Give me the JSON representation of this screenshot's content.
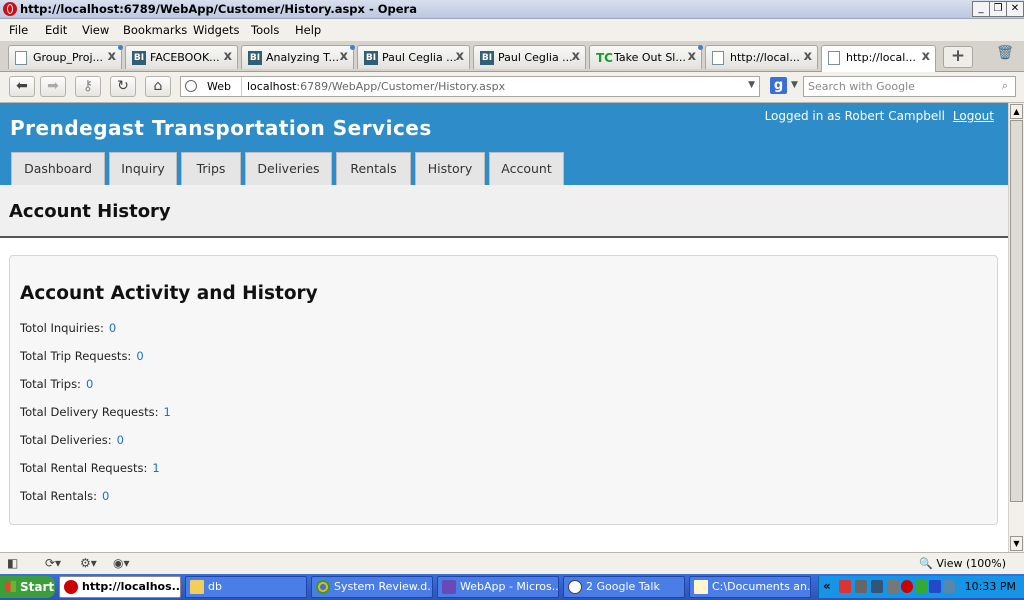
{
  "window": {
    "title": "http://localhost:6789/WebApp/Customer/History.aspx - Opera"
  },
  "menu": [
    "File",
    "Edit",
    "View",
    "Bookmarks",
    "Widgets",
    "Tools",
    "Help"
  ],
  "tabs": [
    {
      "label": "Group_Proj...",
      "icon": "page-icon"
    },
    {
      "label": "FACEBOOK...",
      "icon": "bi-icon"
    },
    {
      "label": "Analyzing T...",
      "icon": "bi-icon"
    },
    {
      "label": "Paul Ceglia ...",
      "icon": "bi-icon"
    },
    {
      "label": "Paul Ceglia ...",
      "icon": "bi-icon"
    },
    {
      "label": "Take Out Sl...",
      "icon": "tc-icon",
      "icon_text": "TC"
    },
    {
      "label": "http://local...",
      "icon": "page-icon"
    },
    {
      "label": "http://local...",
      "icon": "page-icon",
      "active": true
    }
  ],
  "address": {
    "mode": "Web",
    "url_host": "localhost",
    "url_rest": ":6789/WebApp/Customer/History.aspx"
  },
  "search": {
    "placeholder": "Search with Google"
  },
  "site": {
    "title": "Prendegast Transportation Services",
    "login_text": "Logged in as Robert Campbell",
    "logout_label": "Logout",
    "nav": [
      "Dashboard",
      "Inquiry",
      "Trips",
      "Deliveries",
      "Rentals",
      "History",
      "Account"
    ]
  },
  "page": {
    "heading": "Account History",
    "section_title": "Account Activity and History",
    "stats": [
      {
        "label": "Totol Inquiries:",
        "value": "0"
      },
      {
        "label": "Total Trip Requests:",
        "value": "0"
      },
      {
        "label": "Total Trips:",
        "value": "0"
      },
      {
        "label": "Total Delivery Requests:",
        "value": "1"
      },
      {
        "label": "Total Deliveries:",
        "value": "0"
      },
      {
        "label": "Total Rental Requests:",
        "value": "1"
      },
      {
        "label": "Total Rentals:",
        "value": "0"
      }
    ]
  },
  "statusbar": {
    "zoom": "View (100%)"
  },
  "taskbar": {
    "start": "Start",
    "items": [
      {
        "label": "http://localhos...",
        "icon": "opera-icon",
        "active": true
      },
      {
        "label": "db",
        "icon": "folder-icon"
      },
      {
        "label": "System Review.d...",
        "icon": "chrome-icon"
      },
      {
        "label": "WebApp - Micros...",
        "icon": "visual-studio-icon"
      },
      {
        "label": "2 Google Talk",
        "icon": "google-talk-icon"
      },
      {
        "label": "C:\\Documents an...",
        "icon": "document-icon"
      }
    ],
    "clock": "10:33 PM"
  },
  "colors": {
    "header_blue": "#2e8dc8",
    "link_blue": "#1f6fc1",
    "taskbar_blue": "#2a55b8"
  }
}
